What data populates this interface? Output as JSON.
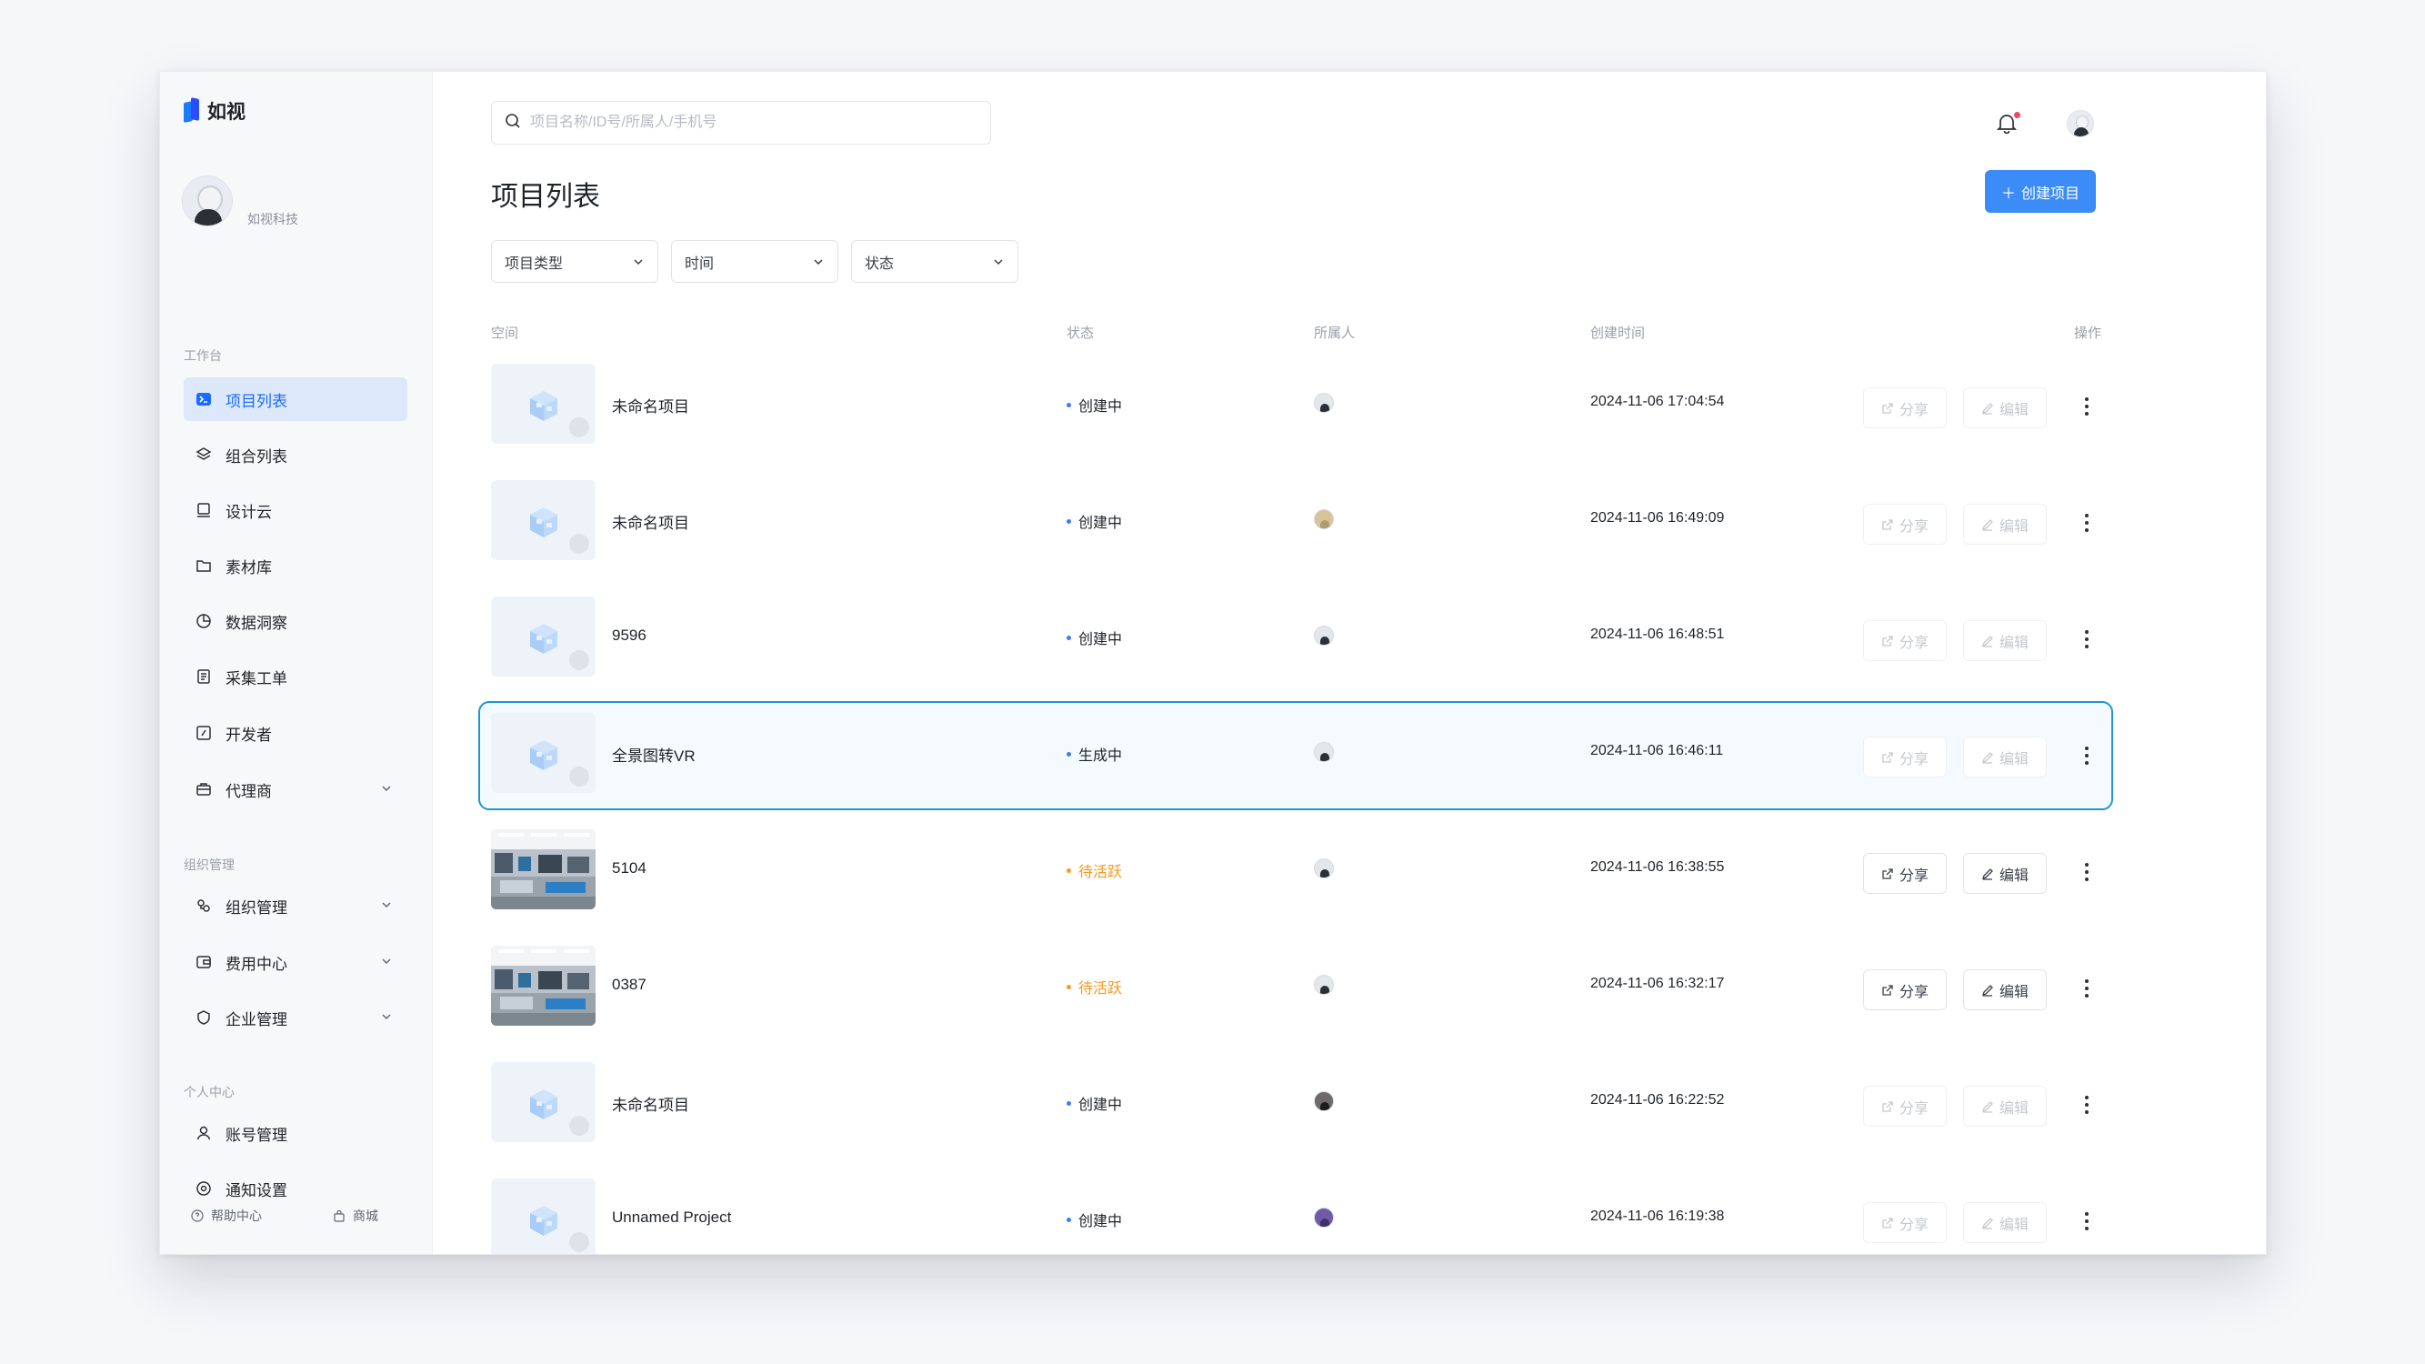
{
  "brand": {
    "name": "如视"
  },
  "user": {
    "org": "如视科技"
  },
  "sidebar": {
    "sections": [
      {
        "label": "工作台"
      },
      {
        "label": "组织管理"
      },
      {
        "label": "个人中心"
      }
    ],
    "items": [
      {
        "label": "项目列表",
        "icon": "cube-list-icon",
        "active": true
      },
      {
        "label": "组合列表",
        "icon": "layers-icon"
      },
      {
        "label": "设计云",
        "icon": "monitor-icon"
      },
      {
        "label": "素材库",
        "icon": "folder-icon"
      },
      {
        "label": "数据洞察",
        "icon": "pie-chart-icon"
      },
      {
        "label": "采集工单",
        "icon": "document-icon"
      },
      {
        "label": "开发者",
        "icon": "code-icon"
      },
      {
        "label": "代理商",
        "icon": "briefcase-icon",
        "expandable": true
      },
      {
        "label": "组织管理",
        "icon": "organization-icon",
        "expandable": true
      },
      {
        "label": "费用中心",
        "icon": "wallet-icon",
        "expandable": true
      },
      {
        "label": "企业管理",
        "icon": "shield-icon",
        "expandable": true
      },
      {
        "label": "账号管理",
        "icon": "user-icon"
      },
      {
        "label": "通知设置",
        "icon": "settings-icon"
      }
    ],
    "footer": {
      "help": "帮助中心",
      "store": "商城"
    }
  },
  "header": {
    "search_placeholder": "项目名称/ID号/所属人/手机号"
  },
  "main": {
    "title": "项目列表",
    "create_label": "创建项目",
    "filters": [
      "项目类型",
      "时间",
      "状态"
    ],
    "columns": [
      "空间",
      "状态",
      "所属人",
      "创建时间",
      "操作"
    ],
    "share_label": "分享",
    "edit_label": "编辑",
    "rows": [
      {
        "name": "未命名项目",
        "status": "创建中",
        "status_color": "#3b7cf7",
        "time": "2024-11-06 17:04:54",
        "thumb": "placeholder",
        "enabled": false
      },
      {
        "name": "未命名项目",
        "status": "创建中",
        "status_color": "#3b7cf7",
        "time": "2024-11-06 16:49:09",
        "thumb": "placeholder",
        "enabled": false
      },
      {
        "name": "9596",
        "status": "创建中",
        "status_color": "#3b7cf7",
        "time": "2024-11-06 16:48:51",
        "thumb": "placeholder",
        "enabled": false
      },
      {
        "name": "全景图转VR",
        "status": "生成中",
        "status_color": "#3b7cf7",
        "time": "2024-11-06 16:46:11",
        "thumb": "placeholder",
        "enabled": false,
        "selected": true
      },
      {
        "name": "5104",
        "status": "待活跃",
        "status_color": "#f59a23",
        "time": "2024-11-06 16:38:55",
        "thumb": "photo",
        "enabled": true
      },
      {
        "name": "0387",
        "status": "待活跃",
        "status_color": "#f59a23",
        "time": "2024-11-06 16:32:17",
        "thumb": "photo",
        "enabled": true
      },
      {
        "name": "未命名项目",
        "status": "创建中",
        "status_color": "#3b7cf7",
        "time": "2024-11-06 16:22:52",
        "thumb": "placeholder",
        "enabled": false
      },
      {
        "name": "Unnamed Project",
        "status": "创建中",
        "status_color": "#3b7cf7",
        "time": "2024-11-06 16:19:38",
        "thumb": "placeholder",
        "enabled": false
      }
    ]
  },
  "colors": {
    "accent": "#3b8cf7",
    "active_nav_bg": "#dde9fb",
    "selected_row_border": "#1f95d9",
    "notification_dot": "#f5475b"
  }
}
